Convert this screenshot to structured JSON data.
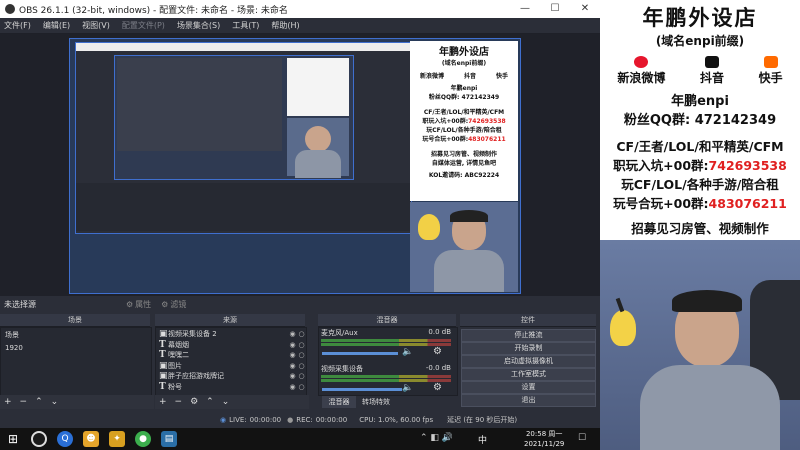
{
  "window": {
    "title": "OBS 26.1.1 (32-bit, windows) - 配置文件: 未命名 - 场景: 未命名",
    "minimize": "—",
    "maximize": "☐",
    "close": "✕"
  },
  "menu": [
    "文件(F)",
    "编辑(E)",
    "视图(V)",
    "配置文件(P)",
    "场景集合(S)",
    "工具(T)",
    "帮助(H)"
  ],
  "source_status": {
    "label": "未选择源",
    "properties_label": "属性",
    "filters_label": "滤镜"
  },
  "docks": {
    "scenes_title": "场景",
    "sources_title": "来源",
    "mixer_title": "混音器",
    "controls_title": "控件"
  },
  "scenes": [
    "场景",
    "1920"
  ],
  "sources": [
    {
      "label": "视频采集设备 2",
      "type": "video"
    },
    {
      "label": "幕烟烟",
      "type": "text"
    },
    {
      "label": "嘿嘿二",
      "type": "text"
    },
    {
      "label": "图片",
      "type": "image"
    },
    {
      "label": "胖子应招游戏牌记",
      "type": "image"
    },
    {
      "label": "粉号",
      "type": "text"
    },
    {
      "label": "素材",
      "type": "text"
    }
  ],
  "mixer": {
    "channels": [
      {
        "name": "麦克风/Aux",
        "db": "0.0 dB",
        "level": 0.72
      },
      {
        "name": "视频采集设备",
        "db": "-0.0 dB",
        "level": 0.78
      }
    ],
    "tab_mixer": "混音器",
    "tab_transition": "转场特效"
  },
  "controls": [
    "停止推流",
    "开始录制",
    "启动虚拟摄像机",
    "工作室模式",
    "设置",
    "退出"
  ],
  "statusbar": {
    "live_label": "LIVE:",
    "live_time": "00:00:00",
    "rec_label": "REC:",
    "rec_time": "00:00:00",
    "cpu": "CPU: 1.0%, 60.00 fps",
    "delay": "延迟 (在 90 秒后开始)"
  },
  "taskbar": {
    "time": "20:58 周一",
    "date": "2021/11/29",
    "ime": "中",
    "notif": "☐"
  },
  "panel": {
    "title": "年鹏外设店",
    "subtitle": "(域名enpi前缀)",
    "social": [
      "新浪微博",
      "抖音",
      "快手"
    ],
    "handle": "年鹏enpi",
    "qq_line": "粉丝QQ群: 472142349",
    "game_line": "CF/王者/LOL/和平精英/CFM",
    "group1_label": "职玩入坑+00群:",
    "group1_num": "742693538",
    "game_line2": "玩CF/LOL/各种手游/陪合租",
    "group2_label": "玩号合玩+00群:",
    "group2_num": "483076211",
    "recruit1": "招募见习房管、视频制作",
    "recruit2": "自媒体运营, 详情见鱼吧",
    "kol_line": "KOL邀请码: ABC92224"
  },
  "colors": {
    "obs_bg": "#2b2e38",
    "canvas_border": "#3f6fcf",
    "accent_red": "#e02020",
    "panel_bg": "#ffffff"
  }
}
